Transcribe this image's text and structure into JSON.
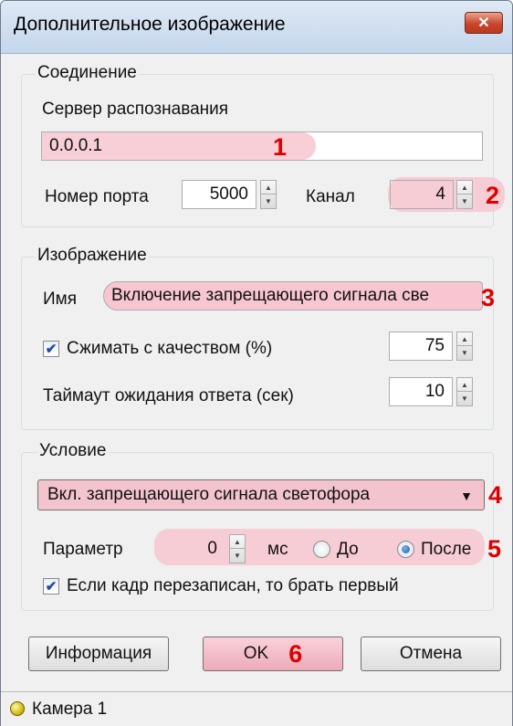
{
  "window": {
    "title": "Дополнительное изображение",
    "close_glyph": "✕"
  },
  "connection": {
    "legend": "Соединение",
    "server_label": "Сервер распознавания",
    "server_value": "0.0.0.1",
    "port_label": "Номер порта",
    "port_value": "5000",
    "channel_label": "Канал",
    "channel_value": "4"
  },
  "image": {
    "legend": "Изображение",
    "name_label": "Имя",
    "name_value": "Включение запрещающего сигнала све",
    "compress_label": "Сжимать с качеством (%)",
    "compress_checked": true,
    "compress_value": "75",
    "timeout_label": "Таймаут ожидания ответа (сек)",
    "timeout_value": "10"
  },
  "condition": {
    "legend": "Условие",
    "selected": "Вкл. запрещающего сигнала светофора",
    "param_label": "Параметр",
    "param_value": "0",
    "unit_label": "мс",
    "before_label": "До",
    "after_label": "После",
    "selected_timing": "after",
    "overwrite_label": "Если кадр перезаписан, то брать первый",
    "overwrite_checked": true
  },
  "buttons": {
    "info": "Информация",
    "ok": "OK",
    "cancel": "Отмена"
  },
  "status": {
    "camera": "Камера 1"
  },
  "markers": [
    "1",
    "2",
    "3",
    "4",
    "5",
    "6"
  ],
  "colors": {
    "highlight": "#f7c6d0",
    "marker": "#e00000"
  },
  "icons": {
    "spin_up": "▲",
    "spin_down": "▼",
    "check": "✔",
    "dropdown": "▼"
  }
}
